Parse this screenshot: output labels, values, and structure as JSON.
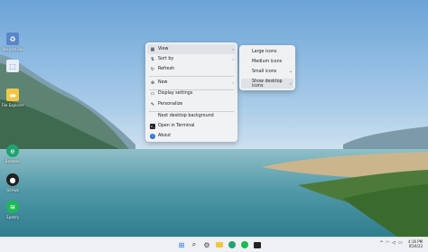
{
  "desktop": {
    "icons": [
      {
        "name": "Recycle Bin",
        "icon": "recycle-bin-icon",
        "color": "#5b86c6"
      },
      {
        "name": "",
        "icon": "store-icon",
        "color": "#2f7fd6"
      },
      {
        "name": "File Explorer",
        "icon": "folder-icon",
        "color": "#f2c744"
      },
      {
        "name": "Browser",
        "icon": "edge-icon",
        "color": "#1fa370"
      },
      {
        "name": "GitHub",
        "icon": "github-icon",
        "color": "#222222"
      },
      {
        "name": "Spotify",
        "icon": "spotify-icon",
        "color": "#1db954"
      }
    ]
  },
  "context_menu": {
    "items": [
      {
        "label": "View",
        "icon": "grid-view-icon",
        "submenu": true
      },
      {
        "label": "Sort by",
        "icon": "sort-icon",
        "submenu": true
      },
      {
        "label": "Refresh",
        "icon": "refresh-icon",
        "submenu": false
      },
      {
        "label": "New",
        "icon": "plus-icon",
        "submenu": true
      },
      {
        "label": "Display settings",
        "icon": "display-icon",
        "submenu": false
      },
      {
        "label": "Personalize",
        "icon": "pen-icon",
        "submenu": false
      },
      {
        "label": "Next desktop background",
        "icon": "",
        "submenu": false
      },
      {
        "label": "Open in Terminal",
        "icon": "terminal-icon",
        "submenu": false
      },
      {
        "label": "About",
        "icon": "info-icon",
        "submenu": false
      }
    ]
  },
  "view_submenu": {
    "items": [
      {
        "label": "Large icons"
      },
      {
        "label": "Medium icons"
      },
      {
        "label": "Small icons",
        "checked": true
      },
      {
        "label": "Show desktop icons",
        "checked": true
      }
    ]
  },
  "taskbar": {
    "icons": [
      "windows-start-icon",
      "search-icon",
      "settings-icon",
      "file-explorer-icon",
      "edge-icon",
      "spotify-icon",
      "terminal-icon"
    ],
    "tray": {
      "time": "4:16 PM",
      "date": "05/4/22"
    }
  },
  "colors": {
    "menu_bg": "#f3f3f3",
    "highlight": "#dfe2e6",
    "taskbar_bg": "#eef0f4"
  }
}
